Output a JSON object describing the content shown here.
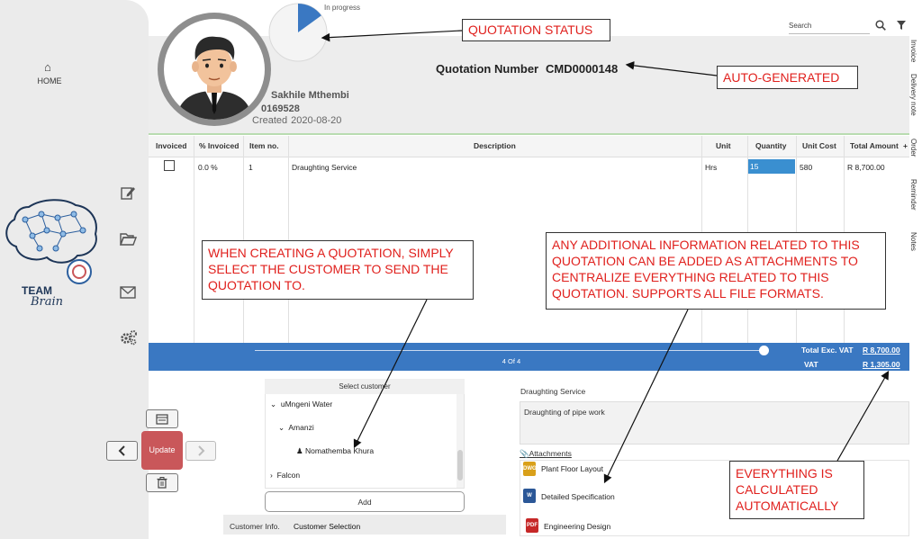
{
  "sidebar": {
    "home_label": "HOME",
    "brand_line1": "TEAM",
    "brand_line2": "Brain"
  },
  "search": {
    "placeholder": "Search"
  },
  "status": {
    "label": "In progress",
    "progress_fraction": 0.15
  },
  "customer": {
    "name": "Sakhile Mthembi",
    "number": "0169528",
    "created_label": "Created",
    "created_date": "2020-08-20"
  },
  "quotation": {
    "number_label": "Quotation Number",
    "number_value": "CMD0000148"
  },
  "right_tabs": [
    "Invoice",
    "Delivery note",
    "Order",
    "Reminder",
    "Notes"
  ],
  "table": {
    "headers": [
      "Invoiced",
      "% Invoiced",
      "Item no.",
      "Description",
      "Unit",
      "Quantity",
      "Unit Cost",
      "Total Amount"
    ],
    "add_column": "+",
    "row": {
      "invoiced": false,
      "percent": "0.0 %",
      "item_no": "1",
      "description": "Draughting Service",
      "unit": "Hrs",
      "quantity": "15",
      "unit_cost": "580",
      "total": "R 8,700.00"
    }
  },
  "footer": {
    "page_indicator": "4 Of 4",
    "total_label": "Total Exc. VAT",
    "total_value": "R 8,700.00",
    "vat_label": "VAT",
    "vat_value": "R 1,305.00"
  },
  "controls": {
    "update_label": "Update"
  },
  "customer_select": {
    "header": "Select customer",
    "items": [
      "uMngeni Water",
      "Amanzi",
      "Nomathemba Khura",
      "Falcon"
    ],
    "add_label": "Add",
    "info_label": "Customer Info.",
    "info_value": "Customer Selection"
  },
  "details": {
    "title": "Draughting Service",
    "text": "Draughting of pipe work"
  },
  "attachments": {
    "title": "Attachments",
    "items": [
      "Plant Floor Layout",
      "Detailed Specification",
      "Engineering Design"
    ]
  },
  "callouts": {
    "status": "QUOTATION STATUS",
    "auto": "AUTO-GENERATED",
    "customer": "WHEN CREATING A QUOTATION, SIMPLY SELECT THE CUSTOMER TO SEND THE QUOTATION TO.",
    "attachments": "ANY ADDITIONAL INFORMATION RELATED TO THIS QUOTATION CAN BE ADDED AS ATTACHMENTS TO CENTRALIZE EVERYTHING RELATED TO THIS QUOTATION. SUPPORTS ALL FILE FORMATS.",
    "calc": "EVERYTHING IS CALCULATED AUTOMATICALLY"
  },
  "colors": {
    "accent_blue": "#3a78c2",
    "update_red": "#c9575a",
    "callout_red": "#e0201d",
    "pie_blue": "#3a78c2"
  }
}
